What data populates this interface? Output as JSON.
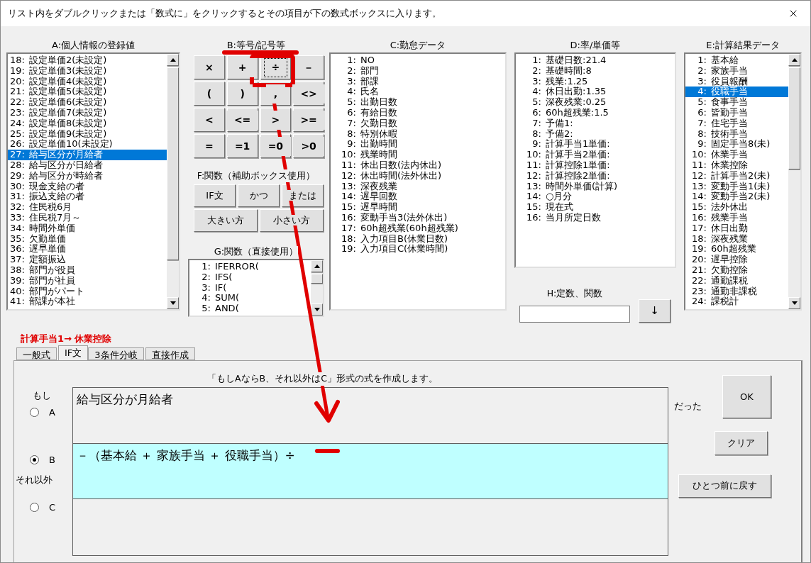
{
  "window": {
    "title": "リスト内をダブルクリックまたは「数式に」をクリックするとその項目が下の数式ボックスに入ります。"
  },
  "lists": [
    {
      "label": "A:個人情報の登録値",
      "kind": "scrolling",
      "items": [
        {
          "no": "18:",
          "text": "設定単価2(未設定)",
          "selected": false
        },
        {
          "no": "19:",
          "text": "設定単価3(未設定)",
          "selected": false
        },
        {
          "no": "20:",
          "text": "設定単価4(未設定)",
          "selected": false
        },
        {
          "no": "21:",
          "text": "設定単価5(未設定)",
          "selected": false
        },
        {
          "no": "22:",
          "text": "設定単価6(未設定)",
          "selected": false
        },
        {
          "no": "23:",
          "text": "設定単価7(未設定)",
          "selected": false
        },
        {
          "no": "24:",
          "text": "設定単価8(未設定)",
          "selected": false
        },
        {
          "no": "25:",
          "text": "設定単価9(未設定)",
          "selected": false
        },
        {
          "no": "26:",
          "text": "設定単価10(未設定)",
          "selected": false
        },
        {
          "no": "27:",
          "text": "給与区分が月給者",
          "selected": true
        },
        {
          "no": "28:",
          "text": "給与区分が日給者",
          "selected": false
        },
        {
          "no": "29:",
          "text": "給与区分が時給者",
          "selected": false
        },
        {
          "no": "30:",
          "text": "現金支給の者",
          "selected": false
        },
        {
          "no": "31:",
          "text": "振込支給の者",
          "selected": false
        },
        {
          "no": "32:",
          "text": "住民税6月",
          "selected": false
        },
        {
          "no": "33:",
          "text": "住民税7月～",
          "selected": false
        },
        {
          "no": "34:",
          "text": "時間外単価",
          "selected": false
        },
        {
          "no": "35:",
          "text": "欠勤単価",
          "selected": false
        },
        {
          "no": "36:",
          "text": "遅早単価",
          "selected": false
        },
        {
          "no": "37:",
          "text": "定額振込",
          "selected": false
        },
        {
          "no": "38:",
          "text": "部門が役員",
          "selected": false
        },
        {
          "no": "39:",
          "text": "部門が社員",
          "selected": false
        },
        {
          "no": "40:",
          "text": "部門がパート",
          "selected": false
        },
        {
          "no": "41:",
          "text": "部課が本社",
          "selected": false
        }
      ]
    },
    {
      "label": "C:勤怠データ",
      "kind": "plain",
      "items": [
        {
          "no": "1:",
          "text": "NO",
          "selected": false
        },
        {
          "no": "2:",
          "text": "部門",
          "selected": false
        },
        {
          "no": "3:",
          "text": "部課",
          "selected": false
        },
        {
          "no": "4:",
          "text": "氏名",
          "selected": false
        },
        {
          "no": "5:",
          "text": "出勤日数",
          "selected": false
        },
        {
          "no": "6:",
          "text": "有給日数",
          "selected": false
        },
        {
          "no": "7:",
          "text": "欠勤日数",
          "selected": false
        },
        {
          "no": "8:",
          "text": "特別休暇",
          "selected": false
        },
        {
          "no": "9:",
          "text": "出勤時間",
          "selected": false
        },
        {
          "no": "10:",
          "text": "残業時間",
          "selected": false
        },
        {
          "no": "11:",
          "text": "休出日数(法内休出)",
          "selected": false
        },
        {
          "no": "12:",
          "text": "休出時間(法外休出)",
          "selected": false
        },
        {
          "no": "13:",
          "text": "深夜残業",
          "selected": false
        },
        {
          "no": "14:",
          "text": "遅早回数",
          "selected": false
        },
        {
          "no": "15:",
          "text": "遅早時間",
          "selected": false
        },
        {
          "no": "16:",
          "text": "変動手当3(法外休出)",
          "selected": false
        },
        {
          "no": "17:",
          "text": "60h超残業(60h超残業)",
          "selected": false
        },
        {
          "no": "18:",
          "text": "入力項目B(休業日数)",
          "selected": false
        },
        {
          "no": "19:",
          "text": "入力項目C(休業時間)",
          "selected": false
        }
      ]
    },
    {
      "label": "D:率/単価等",
      "kind": "plain",
      "items": [
        {
          "no": "1:",
          "text": "基礎日数:21.4",
          "selected": false
        },
        {
          "no": "2:",
          "text": "基礎時間:8",
          "selected": false
        },
        {
          "no": "3:",
          "text": "残業:1.25",
          "selected": false
        },
        {
          "no": "4:",
          "text": "休日出勤:1.35",
          "selected": false
        },
        {
          "no": "5:",
          "text": "深夜残業:0.25",
          "selected": false
        },
        {
          "no": "6:",
          "text": "60h超残業:1.5",
          "selected": false
        },
        {
          "no": "7:",
          "text": "予備1:",
          "selected": false
        },
        {
          "no": "8:",
          "text": "予備2:",
          "selected": false
        },
        {
          "no": "9:",
          "text": "計算手当1単価:",
          "selected": false
        },
        {
          "no": "10:",
          "text": "計算手当2単価:",
          "selected": false
        },
        {
          "no": "11:",
          "text": "計算控除1単価:",
          "selected": false
        },
        {
          "no": "12:",
          "text": "計算控除2単価:",
          "selected": false
        },
        {
          "no": "13:",
          "text": "時間外単価(計算)",
          "selected": false
        },
        {
          "no": "14:",
          "text": "○月分",
          "selected": false
        },
        {
          "no": "15:",
          "text": "現在式",
          "selected": false
        },
        {
          "no": "16:",
          "text": "当月所定日数",
          "selected": false
        }
      ]
    },
    {
      "label": "E:計算結果データ",
      "kind": "scrolling",
      "items": [
        {
          "no": "1:",
          "text": "基本給",
          "selected": false
        },
        {
          "no": "2:",
          "text": "家族手当",
          "selected": false
        },
        {
          "no": "3:",
          "text": "役員報酬",
          "selected": false
        },
        {
          "no": "4:",
          "text": "役職手当",
          "selected": true
        },
        {
          "no": "5:",
          "text": "食事手当",
          "selected": false
        },
        {
          "no": "6:",
          "text": "皆勤手当",
          "selected": false
        },
        {
          "no": "7:",
          "text": "住宅手当",
          "selected": false
        },
        {
          "no": "8:",
          "text": "技術手当",
          "selected": false
        },
        {
          "no": "9:",
          "text": "固定手当8(未)",
          "selected": false
        },
        {
          "no": "10:",
          "text": "休業手当",
          "selected": false
        },
        {
          "no": "11:",
          "text": "休業控除",
          "selected": false
        },
        {
          "no": "12:",
          "text": "計算手当2(未)",
          "selected": false
        },
        {
          "no": "13:",
          "text": "変動手当1(未)",
          "selected": false
        },
        {
          "no": "14:",
          "text": "変動手当2(未)",
          "selected": false
        },
        {
          "no": "15:",
          "text": "法外休出",
          "selected": false
        },
        {
          "no": "16:",
          "text": "残業手当",
          "selected": false
        },
        {
          "no": "17:",
          "text": "休日出勤",
          "selected": false
        },
        {
          "no": "18:",
          "text": "深夜残業",
          "selected": false
        },
        {
          "no": "19:",
          "text": "60h超残業",
          "selected": false
        },
        {
          "no": "20:",
          "text": "遅早控除",
          "selected": false
        },
        {
          "no": "21:",
          "text": "欠勤控除",
          "selected": false
        },
        {
          "no": "22:",
          "text": "通勤課税",
          "selected": false
        },
        {
          "no": "23:",
          "text": "通勤非課税",
          "selected": false
        },
        {
          "no": "24:",
          "text": "課税計",
          "selected": false
        }
      ]
    }
  ],
  "symbols": {
    "label": "B:等号/記号等",
    "buttons": [
      {
        "text": "×",
        "focused": false
      },
      {
        "text": "+",
        "focused": false
      },
      {
        "text": "÷",
        "focused": true
      },
      {
        "text": "－",
        "focused": false
      },
      {
        "text": "(",
        "focused": false
      },
      {
        "text": ")",
        "focused": false
      },
      {
        "text": ",",
        "focused": false
      },
      {
        "text": "<>",
        "focused": false
      },
      {
        "text": "<",
        "focused": false
      },
      {
        "text": "<=",
        "focused": false
      },
      {
        "text": ">",
        "focused": false
      },
      {
        "text": ">=",
        "focused": false
      },
      {
        "text": "=",
        "focused": false
      },
      {
        "text": "=1",
        "focused": false
      },
      {
        "text": "=0",
        "focused": false
      },
      {
        "text": ">0",
        "focused": false
      }
    ]
  },
  "helper_functions": {
    "label": "F:関数（補助ボックス使用）",
    "buttons": [
      {
        "text": "IF文",
        "kind": "narrow"
      },
      {
        "text": "かつ",
        "kind": "narrow"
      },
      {
        "text": "または",
        "kind": "narrow"
      },
      {
        "text": "大きい方",
        "kind": "wide"
      },
      {
        "text": "小さい方",
        "kind": "wide"
      }
    ]
  },
  "direct_functions": {
    "label": "G:関数（直接使用）",
    "kind": "scrolling",
    "items": [
      {
        "no": "1:",
        "text": "IFERROR(",
        "selected": false
      },
      {
        "no": "2:",
        "text": "IFS(",
        "selected": false
      },
      {
        "no": "3:",
        "text": "IF(",
        "selected": false
      },
      {
        "no": "4:",
        "text": "SUM(",
        "selected": false
      },
      {
        "no": "5:",
        "text": "AND(",
        "selected": false
      }
    ]
  },
  "constants": {
    "label": "H:定数、関数",
    "button": "↓"
  },
  "target": "計算手当1→ 休業控除",
  "tabs": [
    {
      "label": "一般式",
      "selected": false
    },
    {
      "label": "IF文",
      "selected": true
    },
    {
      "label": "3条件分岐",
      "selected": false
    },
    {
      "label": "直接作成",
      "selected": false
    }
  ],
  "notice": "「もしAならB、それ以外はC」形式の式を作成します。",
  "rows": [
    {
      "caption": "もし",
      "label": "A",
      "selected": false,
      "value": "給与区分が月給者",
      "after": "だった"
    },
    {
      "label": "B",
      "selected": true,
      "value": "－（基本給 ＋ 家族手当 ＋ 役職手当）÷"
    },
    {
      "caption": "それ以外",
      "label": "C",
      "selected": false
    }
  ],
  "buttons": [
    "OK",
    "クリア",
    "ひとつ前に戻す"
  ]
}
